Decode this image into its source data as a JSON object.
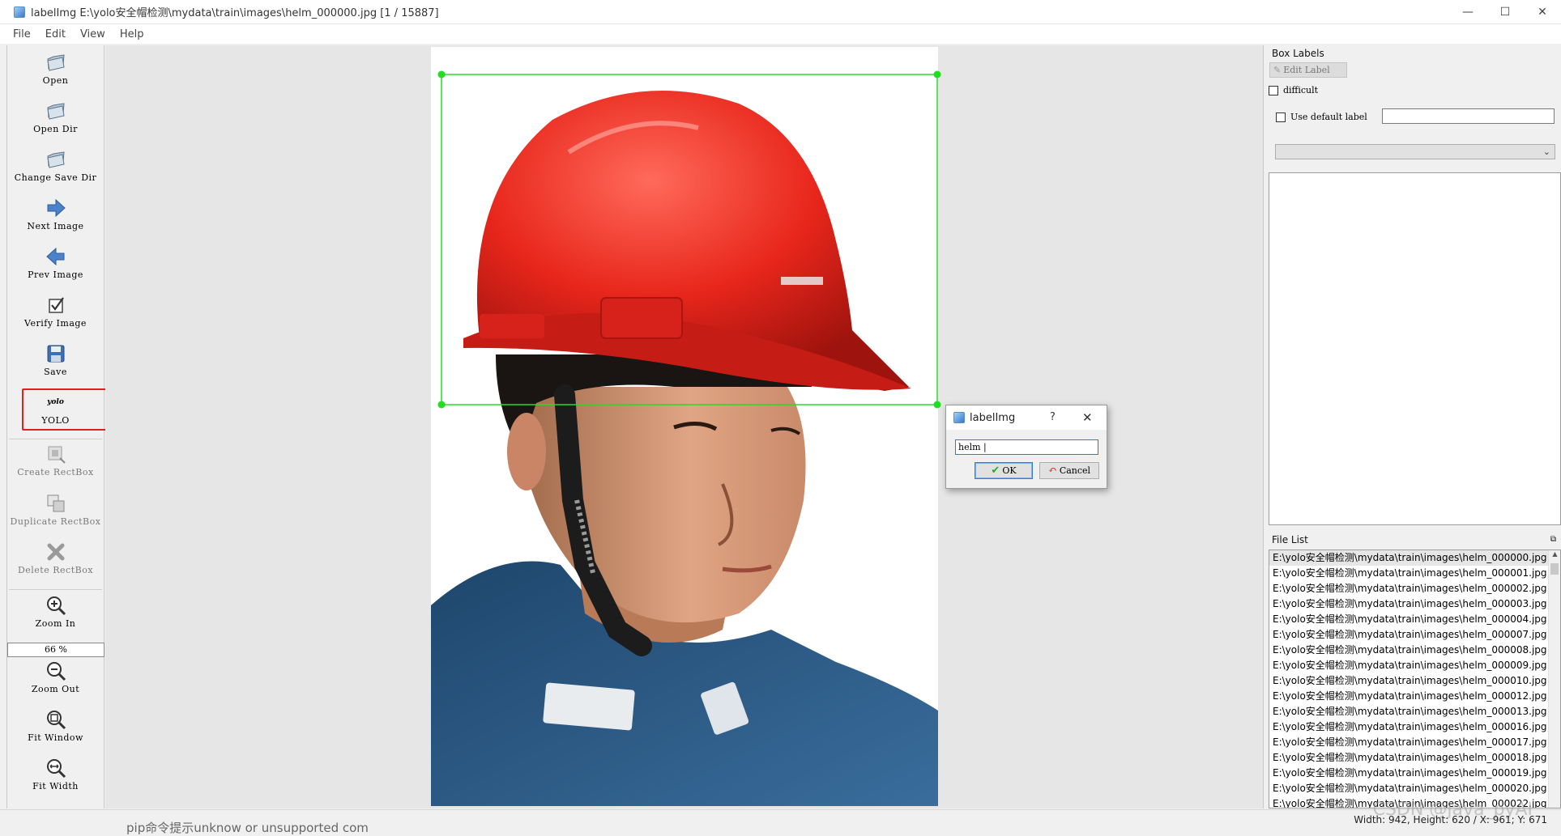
{
  "window": {
    "title": "labelImg E:\\yolo安全帽检测\\mydata\\train\\images\\helm_000000.jpg [1 / 15887]",
    "minimize_glyph": "—",
    "maximize_glyph": "☐",
    "close_glyph": "✕"
  },
  "menu": [
    "File",
    "Edit",
    "View",
    "Help"
  ],
  "toolbar": {
    "open": "Open",
    "open_dir": "Open Dir",
    "change_save_dir": "Change Save Dir",
    "next_image": "Next Image",
    "prev_image": "Prev Image",
    "verify_image": "Verify Image",
    "save": "Save",
    "format_icon_text": "yolo",
    "format": "YOLO",
    "create_rectbox": "Create RectBox",
    "duplicate_rectbox": "Duplicate RectBox",
    "delete_rectbox": "Delete RectBox",
    "zoom_in": "Zoom In",
    "zoom_value": "66 %",
    "zoom_out": "Zoom Out",
    "fit_window": "Fit Window",
    "fit_width": "Fit Width"
  },
  "box_labels": {
    "title": "Box Labels",
    "edit_label": "Edit Label",
    "difficult": "difficult",
    "use_default_label": "Use default label",
    "default_label_value": ""
  },
  "file_list": {
    "title": "File List",
    "items": [
      "E:\\yolo安全帽检测\\mydata\\train\\images\\helm_000000.jpg",
      "E:\\yolo安全帽检测\\mydata\\train\\images\\helm_000001.jpg",
      "E:\\yolo安全帽检测\\mydata\\train\\images\\helm_000002.jpg",
      "E:\\yolo安全帽检测\\mydata\\train\\images\\helm_000003.jpg",
      "E:\\yolo安全帽检测\\mydata\\train\\images\\helm_000004.jpg",
      "E:\\yolo安全帽检测\\mydata\\train\\images\\helm_000007.jpg",
      "E:\\yolo安全帽检测\\mydata\\train\\images\\helm_000008.jpg",
      "E:\\yolo安全帽检测\\mydata\\train\\images\\helm_000009.jpg",
      "E:\\yolo安全帽检测\\mydata\\train\\images\\helm_000010.jpg",
      "E:\\yolo安全帽检测\\mydata\\train\\images\\helm_000012.jpg",
      "E:\\yolo安全帽检测\\mydata\\train\\images\\helm_000013.jpg",
      "E:\\yolo安全帽检测\\mydata\\train\\images\\helm_000016.jpg",
      "E:\\yolo安全帽检测\\mydata\\train\\images\\helm_000017.jpg",
      "E:\\yolo安全帽检测\\mydata\\train\\images\\helm_000018.jpg",
      "E:\\yolo安全帽检测\\mydata\\train\\images\\helm_000019.jpg",
      "E:\\yolo安全帽检测\\mydata\\train\\images\\helm_000020.jpg",
      "E:\\yolo安全帽检测\\mydata\\train\\images\\helm_000022.jpg"
    ]
  },
  "dialog": {
    "title": "labelImg",
    "help": "?",
    "close": "✕",
    "input_value": "helm |",
    "ok": "OK",
    "cancel": "Cancel"
  },
  "status": "Width: 942, Height: 620 / X: 961; Y: 671",
  "background_text": "pip命令提示unknow or unsupported com",
  "watermark": "CSDN @java_pyAI",
  "colors": {
    "bbox": "#22dd22",
    "highlight": "#e02020",
    "helmet": "#e8261c",
    "shirt": "#2e5e8c"
  }
}
